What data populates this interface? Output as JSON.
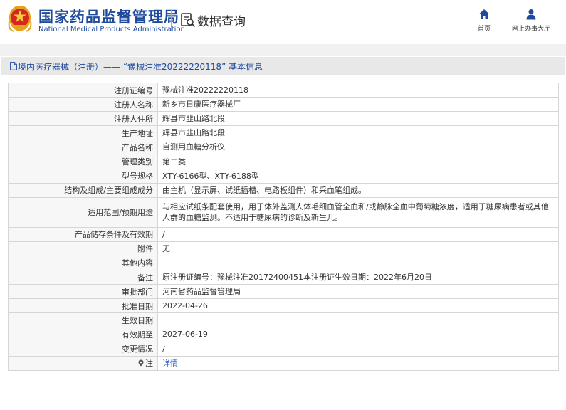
{
  "header": {
    "org_name_cn": "国家药品监督管理局",
    "org_name_en": "National Medical Products Administration",
    "query_title": "数据查询",
    "nav": [
      {
        "label": "首页",
        "icon": "home-icon"
      },
      {
        "label": "网上办事大厅",
        "icon": "user-icon"
      }
    ]
  },
  "section": {
    "title": "境内医疗器械（注册）—— “豫械注准20222220118” 基本信息"
  },
  "rows": [
    {
      "label": "注册证编号",
      "value": "豫械注准20222220118"
    },
    {
      "label": "注册人名称",
      "value": "新乡市日康医疗器械厂"
    },
    {
      "label": "注册人住所",
      "value": "辉县市韭山路北段"
    },
    {
      "label": "生产地址",
      "value": "辉县市韭山路北段"
    },
    {
      "label": "产品名称",
      "value": "自测用血糖分析仪"
    },
    {
      "label": "管理类别",
      "value": "第二类"
    },
    {
      "label": "型号规格",
      "value": "XTY-6166型、XTY-6188型"
    },
    {
      "label": "结构及组成/主要组成成分",
      "value": "由主机（显示屏、试纸插槽、电路板组件）和采血笔组成。"
    },
    {
      "label": "适用范围/预期用途",
      "value": "与相应试纸条配套使用，用于体外监测人体毛细血管全血和/或静脉全血中葡萄糖浓度，适用于糖尿病患者或其他人群的血糖监测。不适用于糖尿病的诊断及新生儿。"
    },
    {
      "label": "产品储存条件及有效期",
      "value": "/"
    },
    {
      "label": "附件",
      "value": "无"
    },
    {
      "label": "其他内容",
      "value": ""
    },
    {
      "label": "备注",
      "value": "原注册证编号：豫械注准20172400451本注册证生效日期：2022年6月20日"
    },
    {
      "label": "审批部门",
      "value": "河南省药品监督管理局"
    },
    {
      "label": "批准日期",
      "value": "2022-04-26"
    },
    {
      "label": "生效日期",
      "value": ""
    },
    {
      "label": "有效期至",
      "value": "2027-06-19"
    },
    {
      "label": "变更情况",
      "value": "/"
    },
    {
      "label": "注",
      "value": "详情"
    }
  ]
}
